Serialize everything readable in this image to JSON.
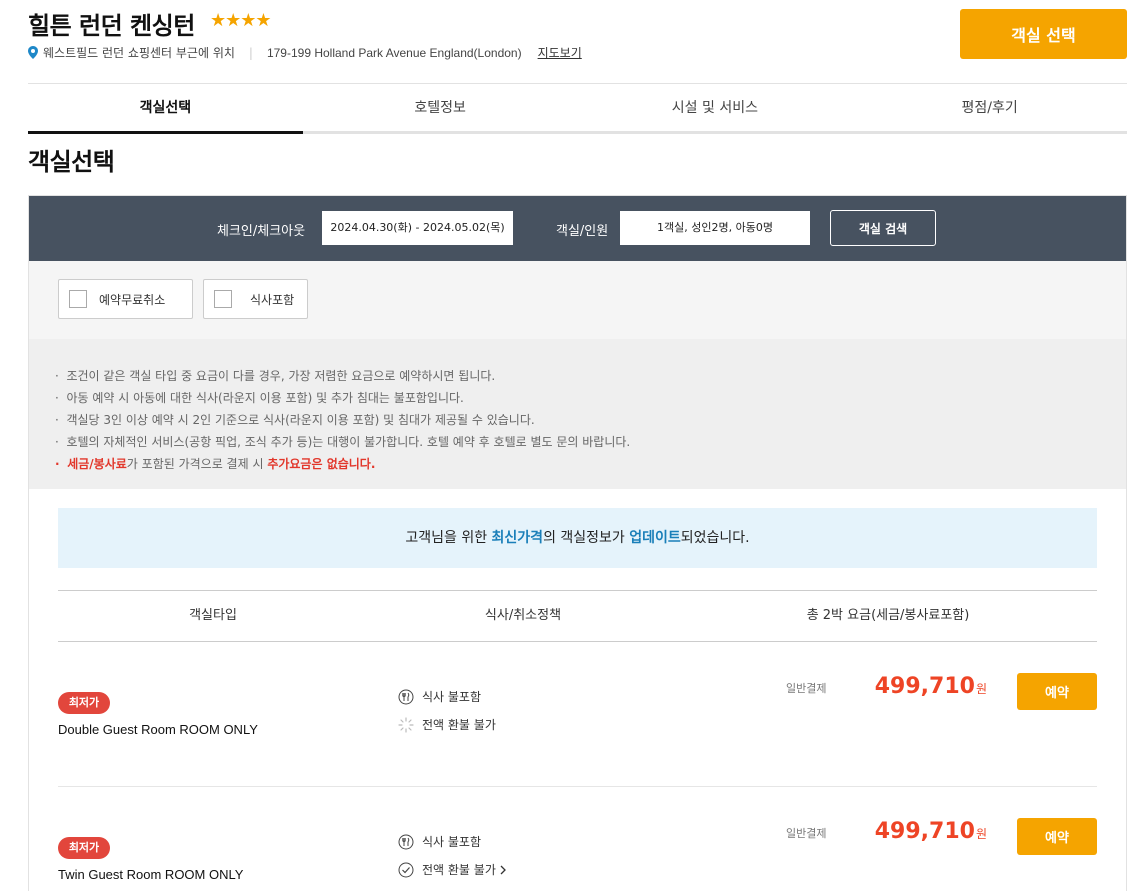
{
  "hotel": {
    "name": "힐튼 런던 켄싱턴",
    "stars": "★★★★",
    "location": "웨스트필드 런던 쇼핑센터 부근에 위치",
    "address": "179-199 Holland Park Avenue England(London)",
    "map_link": "지도보기",
    "select_room_label": "객실 선택"
  },
  "tabs": [
    {
      "label": "객실선택",
      "active": true
    },
    {
      "label": "호텔정보",
      "active": false
    },
    {
      "label": "시설 및 서비스",
      "active": false
    },
    {
      "label": "평점/후기",
      "active": false
    }
  ],
  "section_title": "객실선택",
  "search": {
    "checkin_label": "체크인/체크아웃",
    "checkin_value": "2024.04.30(화)  -  2024.05.02(목)",
    "guests_label": "객실/인원",
    "guests_value": "1객실, 성인2명, 아동0명",
    "search_button": "객실 검색"
  },
  "filters": [
    {
      "label": "예약무료취소",
      "checked": false
    },
    {
      "label": "식사포함",
      "checked": false
    }
  ],
  "notices": [
    "조건이 같은 객실 타입 중 요금이 다를 경우, 가장 저렴한 요금으로 예약하시면 됩니다.",
    "아동 예약 시 아동에 대한 식사(라운지 이용 포함) 및 추가 침대는 불포함입니다.",
    "객실당 3인 이상 예약 시 2인 기준으로 식사(라운지 이용 포함) 및 침대가 제공될 수 있습니다.",
    "호텔의 자체적인 서비스(공항 픽업, 조식 추가 등)는 대행이 불가합니다. 호텔 예약 후 호텔로 별도 문의 바랍니다."
  ],
  "tax_notice": {
    "part1": "세금/봉사료",
    "part2": "가 포함된 가격으로 결제 시 ",
    "part3": "추가요금은 없습니다."
  },
  "update_banner": {
    "part1": "고객님을 위한 ",
    "part2": "최신가격",
    "part3": "의 객실정보가 ",
    "part4": "업데이트",
    "part5": "되었습니다."
  },
  "table": {
    "headers": [
      "객실타입",
      "식사/취소정책",
      "총 2박 요금(세금/봉사료포함)"
    ]
  },
  "rooms": [
    {
      "badge": "최저가",
      "name": "Double Guest Room ROOM ONLY",
      "meal": "식사 불포함",
      "refund": "전액 환불 불가",
      "payment_type": "일반결제",
      "price": "499,710",
      "currency": "원",
      "book_label": "예약"
    },
    {
      "badge": "최저가",
      "name": "Twin Guest Room ROOM ONLY",
      "meal": "식사 불포함",
      "refund": "전액 환불 불가",
      "payment_type": "일반결제",
      "price": "499,710",
      "currency": "원",
      "book_label": "예약"
    }
  ],
  "colors": {
    "accent": "#f5a400",
    "price": "#ee4425",
    "badge": "#e2463c",
    "search_bar": "#475260",
    "highlight_blue": "#1a7fb9"
  }
}
